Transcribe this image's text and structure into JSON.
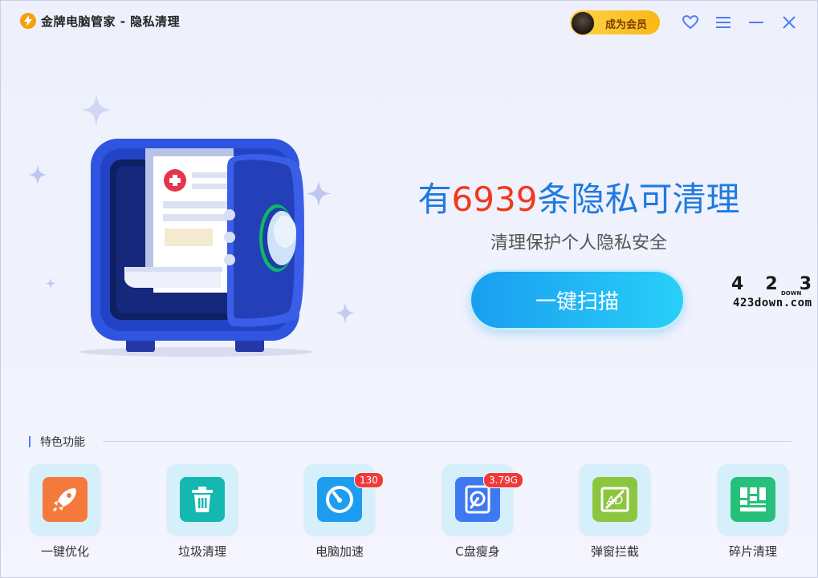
{
  "titlebar": {
    "title": "金牌电脑管家 - 隐私清理",
    "vip_label": "成为会员",
    "icons": [
      "lightning-logo-icon",
      "heart-icon",
      "menu-icon",
      "minimize-icon",
      "close-icon"
    ]
  },
  "hero": {
    "prefix": "有",
    "count": "6939",
    "suffix": "条隐私可清理",
    "subtitle": "清理保护个人隐私安全",
    "scan_button": "一键扫描",
    "accent_color": "#1f7ae0",
    "count_color": "#f0391d"
  },
  "watermark": {
    "top": "423",
    "middle": "DOWN",
    "bottom": "423down.com"
  },
  "features": {
    "section_title": "特色功能",
    "items": [
      {
        "label": "一键优化",
        "icon": "rocket-icon",
        "color": "#f47a3c",
        "badge": ""
      },
      {
        "label": "垃圾清理",
        "icon": "trash-icon",
        "color": "#14b8b0",
        "badge": ""
      },
      {
        "label": "电脑加速",
        "icon": "speedometer-icon",
        "color": "#1d9df0",
        "badge": "130"
      },
      {
        "label": "C盘瘦身",
        "icon": "hard-disk-icon",
        "color": "#3d7af2",
        "badge": "3.79G"
      },
      {
        "label": "弹窗拦截",
        "icon": "popup-block-icon",
        "color": "#8cc63e",
        "badge": ""
      },
      {
        "label": "碎片清理",
        "icon": "fragment-icon",
        "color": "#27c07a",
        "badge": ""
      }
    ]
  }
}
